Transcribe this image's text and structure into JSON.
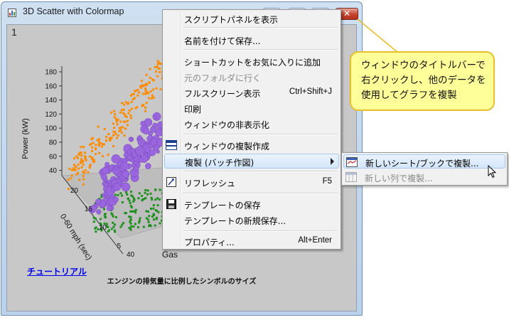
{
  "window": {
    "title": "3D Scatter with Colormap",
    "close_glyph": "✕",
    "page_number": "1"
  },
  "graph": {
    "y_axis_label": "Power (kW)",
    "y_ticks": [
      "180",
      "160",
      "140",
      "120",
      "100",
      "80",
      "60",
      "40"
    ],
    "x_axis_label": "0-60 mph (sec)",
    "x_ticks": [
      "5",
      "10",
      "15",
      "20"
    ],
    "z_axis_label": "Gas",
    "z_tick": "40",
    "tutorial_link": "チュートリアル",
    "caption": "エンジンの排気量に比例したシンボルのサイズ"
  },
  "context_menu": {
    "items": [
      {
        "label": "スクリプトパネルを表示",
        "shortcut": "",
        "enabled": true,
        "icon": ""
      },
      {
        "label": "名前を付けて保存...",
        "shortcut": "",
        "enabled": true,
        "icon": ""
      },
      {
        "label": "ショートカットをお気に入りに追加",
        "shortcut": "",
        "enabled": true,
        "icon": ""
      },
      {
        "label": "元のフォルダに行く",
        "shortcut": "",
        "enabled": false,
        "icon": ""
      },
      {
        "label": "フルスクリーン表示",
        "shortcut": "Ctrl+Shift+J",
        "enabled": true,
        "icon": ""
      },
      {
        "label": "印刷",
        "shortcut": "",
        "enabled": true,
        "icon": ""
      },
      {
        "label": "ウィンドウの非表示化",
        "shortcut": "",
        "enabled": true,
        "icon": ""
      },
      {
        "label": "ウィンドウの複製作成",
        "shortcut": "",
        "enabled": true,
        "icon": "duplicate-window-icon"
      },
      {
        "label": "複製 (バッチ作図)",
        "shortcut": "",
        "enabled": true,
        "icon": "",
        "has_submenu": true,
        "highlighted": true
      },
      {
        "label": "リフレッシュ",
        "shortcut": "F5",
        "enabled": true,
        "icon": "refresh-icon"
      },
      {
        "label": "テンプレートの保存",
        "shortcut": "",
        "enabled": true,
        "icon": "save-template-icon"
      },
      {
        "label": "テンプレートの新規保存...",
        "shortcut": "",
        "enabled": true,
        "icon": ""
      },
      {
        "label": "プロパティ...",
        "shortcut": "Alt+Enter",
        "enabled": true,
        "icon": ""
      }
    ]
  },
  "submenu": {
    "items": [
      {
        "label": "新しいシート/ブックで複製...",
        "enabled": true,
        "highlighted": true,
        "icon": "new-sheet-book-icon"
      },
      {
        "label": "新しい列で複製...",
        "enabled": false,
        "icon": "new-column-icon"
      }
    ]
  },
  "callout": {
    "text": "ウィンドウのタイトルバーで右クリックし、他のデータを使用してグラフを複製"
  },
  "colors": {
    "orange_series": "#ff8c00",
    "purple_series": "#9966dd",
    "green_series": "#1f8f1f",
    "callout_fill": "#ffff99",
    "callout_border": "#e8bd2a"
  }
}
